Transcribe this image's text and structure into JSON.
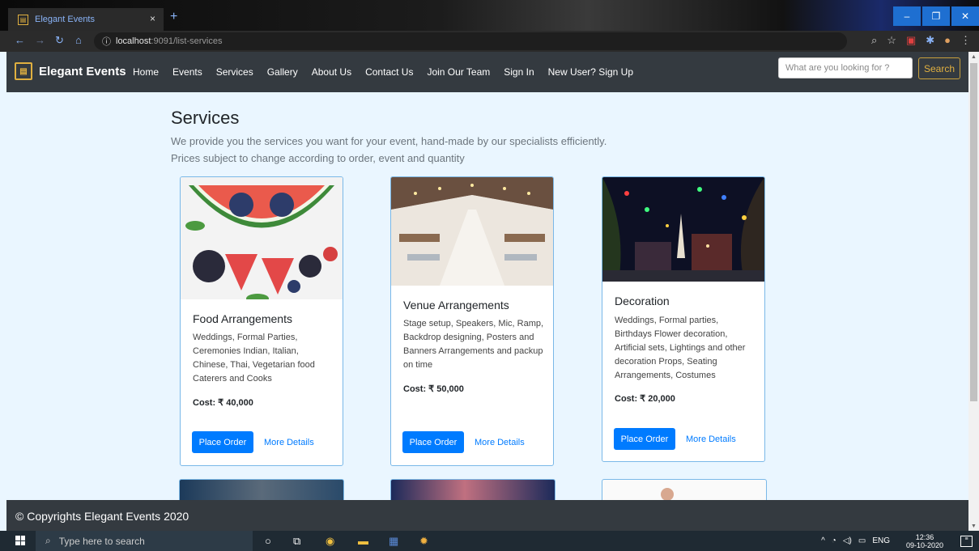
{
  "browser": {
    "tab_title": "Elegant Events",
    "tab_close": "×",
    "new_tab": "+",
    "url_host": "localhost",
    "url_path": ":9091/list-services",
    "window_controls": [
      "–",
      "❐",
      "✕"
    ]
  },
  "nav": {
    "brand": "Elegant Events",
    "links": [
      "Home",
      "Events",
      "Services",
      "Gallery",
      "About Us",
      "Contact Us",
      "Join Our Team",
      "Sign In",
      "New User? Sign Up"
    ],
    "search_placeholder": "What are you looking for ?",
    "search_button": "Search"
  },
  "page": {
    "title": "Services",
    "subtitle_1": "We provide you the services you want for your event, hand-made by our specialists efficiently.",
    "subtitle_2": "Prices subject to change according to order, event and quantity"
  },
  "cards": [
    {
      "title": "Food Arrangements",
      "description": "Weddings, Formal Parties, Ceremonies Indian, Italian, Chinese, Thai, Vegetarian food Caterers and Cooks",
      "cost": "Cost: ₹ 40,000",
      "order_label": "Place Order",
      "details_label": "More Details"
    },
    {
      "title": "Venue Arrangements",
      "description": "Stage setup, Speakers, Mic, Ramp, Backdrop designing, Posters and Banners Arrangements and packup on time",
      "cost": "Cost: ₹ 50,000",
      "order_label": "Place Order",
      "details_label": "More Details"
    },
    {
      "title": "Decoration",
      "description": "Weddings, Formal parties, Birthdays Flower decoration, Artificial sets, Lightings and other decoration Props, Seating Arrangements, Costumes",
      "cost": "Cost: ₹ 20,000",
      "order_label": "Place Order",
      "details_label": "More Details"
    }
  ],
  "footer": {
    "text": "© Copyrights Elegant Events 2020"
  },
  "taskbar": {
    "search_placeholder": "Type here to search",
    "language": "ENG",
    "time": "12:36",
    "date": "09-10-2020"
  },
  "colors": {
    "primary": "#007bff",
    "nav_bg": "#343a40",
    "accent_gold": "#e0b040",
    "page_bg": "#eaf6ff"
  },
  "icons": [
    "back-icon",
    "forward-icon",
    "reload-icon",
    "home-icon",
    "info-icon",
    "zoom-icon",
    "star-icon",
    "pdf-icon",
    "extensions-icon",
    "profile-icon",
    "menu-icon",
    "windows-icon",
    "cortana-icon",
    "task-view-icon",
    "chrome-icon",
    "file-explorer-icon",
    "word-icon",
    "settings-icon"
  ]
}
